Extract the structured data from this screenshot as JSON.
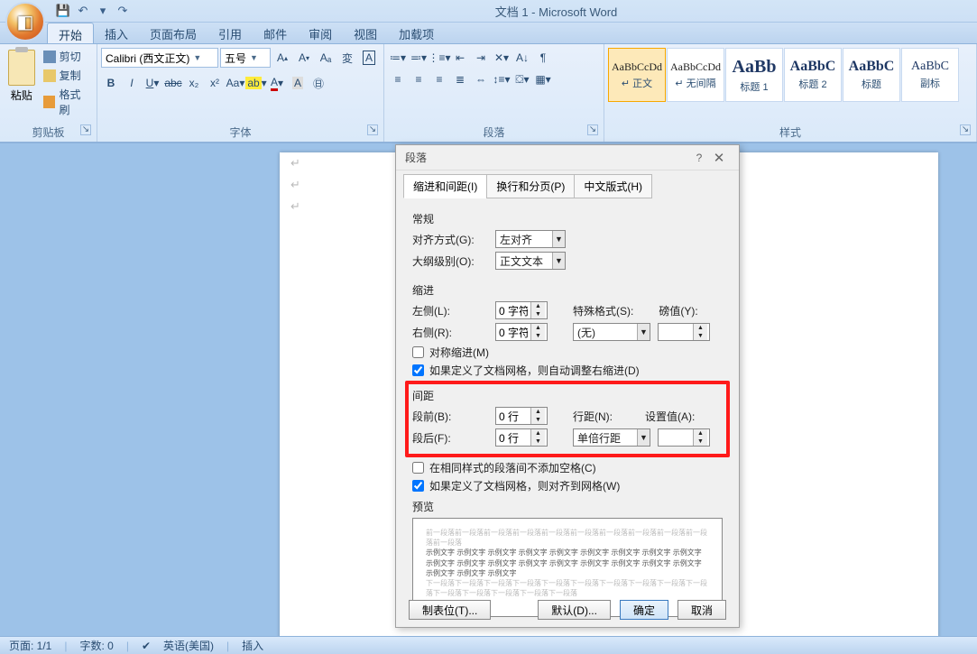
{
  "window": {
    "title": "文档 1 - Microsoft Word"
  },
  "qat": {
    "save": "💾",
    "undo": "↶",
    "redo": "↷"
  },
  "tabs": [
    "开始",
    "插入",
    "页面布局",
    "引用",
    "邮件",
    "审阅",
    "视图",
    "加载项"
  ],
  "active_tab": 0,
  "ribbon": {
    "clipboard": {
      "label": "剪贴板",
      "paste": "粘贴",
      "cut": "剪切",
      "copy": "复制",
      "format_painter": "格式刷"
    },
    "font": {
      "label": "字体",
      "family": "Calibri (西文正文)",
      "size": "五号"
    },
    "paragraph": {
      "label": "段落"
    },
    "styles": {
      "label": "样式",
      "items": [
        {
          "sample": "AaBbCcDd",
          "label": "↵ 正文",
          "selected": true,
          "size": "12px"
        },
        {
          "sample": "AaBbCcDd",
          "label": "↵ 无间隔",
          "size": "12px"
        },
        {
          "sample": "AaBb",
          "label": "标题 1",
          "size": "20px",
          "color": "#1f3864",
          "bold": true
        },
        {
          "sample": "AaBbC",
          "label": "标题 2",
          "size": "16px",
          "color": "#1f3864",
          "bold": true
        },
        {
          "sample": "AaBbC",
          "label": "标题",
          "size": "16px",
          "color": "#1f3864",
          "bold": true
        },
        {
          "sample": "AaBbC",
          "label": "副标",
          "size": "14px",
          "color": "#1f3864"
        }
      ]
    }
  },
  "dialog": {
    "title": "段落",
    "tabs": [
      "缩进和间距(I)",
      "换行和分页(P)",
      "中文版式(H)"
    ],
    "active_tab": 0,
    "general": {
      "label": "常规",
      "align_label": "对齐方式(G):",
      "align_value": "左对齐",
      "outline_label": "大纲级别(O):",
      "outline_value": "正文文本"
    },
    "indent": {
      "section": "缩进",
      "left_label": "左侧(L):",
      "left_value": "0 字符",
      "right_label": "右侧(R):",
      "right_value": "0 字符",
      "special_label": "特殊格式(S):",
      "special_value": "(无)",
      "by_label": "磅值(Y):",
      "by_value": "",
      "mirror": "对称缩进(M)",
      "grid": "如果定义了文档网格，则自动调整右缩进(D)"
    },
    "spacing": {
      "section": "间距",
      "before_label": "段前(B):",
      "before_value": "0 行",
      "after_label": "段后(F):",
      "after_value": "0 行",
      "line_label": "行距(N):",
      "line_value": "单倍行距",
      "at_label": "设置值(A):",
      "at_value": "",
      "same_style": "在相同样式的段落间不添加空格(C)",
      "snap_grid": "如果定义了文档网格，则对齐到网格(W)"
    },
    "preview_label": "预览",
    "buttons": {
      "tabs": "制表位(T)...",
      "default": "默认(D)...",
      "ok": "确定",
      "cancel": "取消"
    }
  },
  "status": {
    "page": "页面: 1/1",
    "words": "字数: 0",
    "lang": "英语(美国)",
    "mode": "插入"
  }
}
